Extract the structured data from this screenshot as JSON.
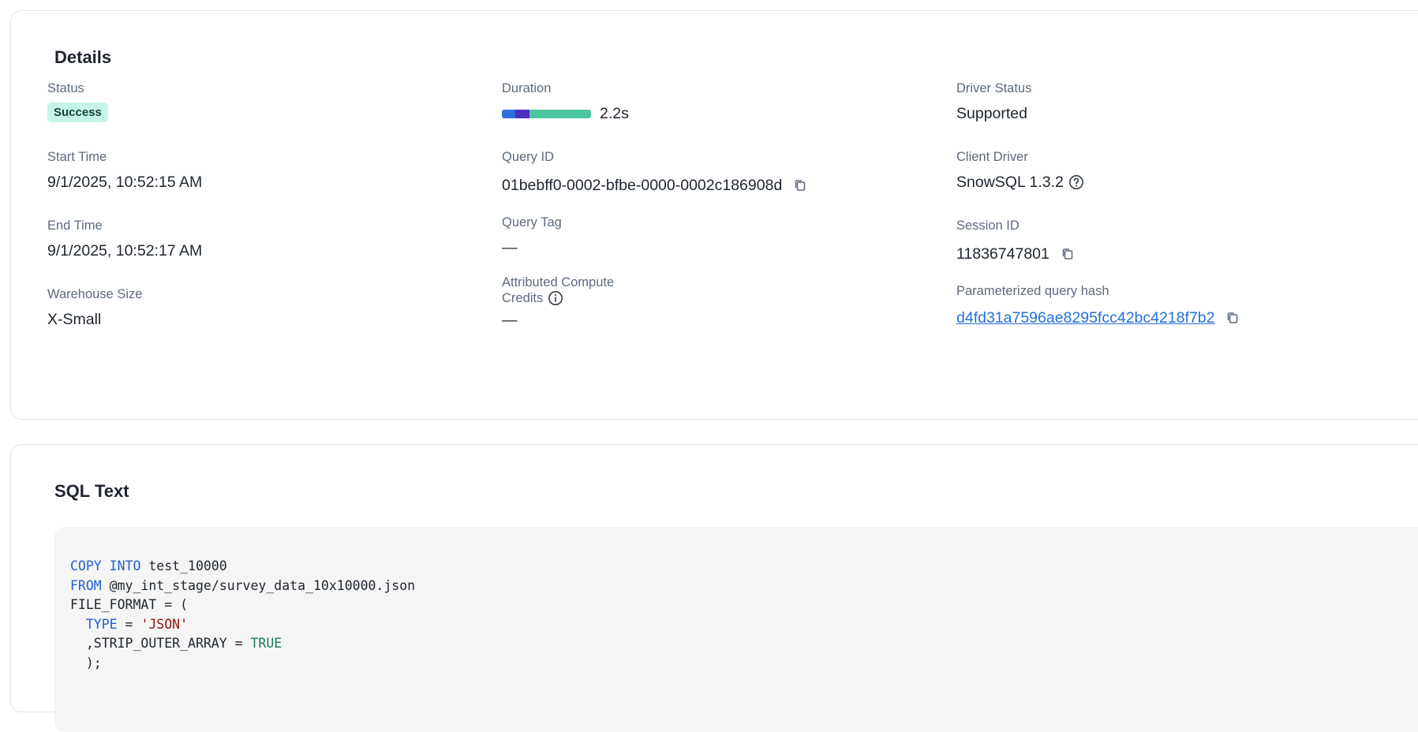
{
  "details": {
    "title": "Details",
    "status": {
      "label": "Status",
      "value": "Success"
    },
    "duration": {
      "label": "Duration",
      "value": "2.2s"
    },
    "driver_status": {
      "label": "Driver Status",
      "value": "Supported"
    },
    "start_time": {
      "label": "Start Time",
      "value": "9/1/2025, 10:52:15 AM"
    },
    "query_id": {
      "label": "Query ID",
      "value": "01bebff0-0002-bfbe-0000-0002c186908d"
    },
    "client_driver": {
      "label": "Client Driver",
      "value": "SnowSQL 1.3.2"
    },
    "end_time": {
      "label": "End Time",
      "value": "9/1/2025, 10:52:17 AM"
    },
    "query_tag": {
      "label": "Query Tag",
      "value": "—"
    },
    "session_id": {
      "label": "Session ID",
      "value": "11836747801"
    },
    "warehouse_size": {
      "label": "Warehouse Size",
      "value": "X-Small"
    },
    "attributed_credits": {
      "label_line1": "Attributed Compute",
      "label_line2": "Credits",
      "value": "—"
    },
    "query_hash": {
      "label": "Parameterized query hash",
      "value": "d4fd31a7596ae8295fcc42bc4218f7b2"
    }
  },
  "sql": {
    "title": "SQL Text",
    "lines": [
      [
        {
          "t": "COPY INTO",
          "c": "kw"
        },
        {
          "t": " test_10000",
          "c": ""
        }
      ],
      [
        {
          "t": "FROM",
          "c": "kw"
        },
        {
          "t": " @my_int_stage/survey_data_10x10000.json",
          "c": ""
        }
      ],
      [
        {
          "t": "FILE_FORMAT = (",
          "c": ""
        }
      ],
      [
        {
          "t": "  ",
          "c": ""
        },
        {
          "t": "TYPE",
          "c": "kw"
        },
        {
          "t": " = ",
          "c": ""
        },
        {
          "t": "'JSON'",
          "c": "str"
        }
      ],
      [
        {
          "t": "  ,STRIP_OUTER_ARRAY = ",
          "c": ""
        },
        {
          "t": "TRUE",
          "c": "bool"
        }
      ],
      [
        {
          "t": "  );",
          "c": ""
        }
      ]
    ]
  },
  "icons": {
    "copy": "copy-icon",
    "help": "question-circle-icon",
    "info": "info-circle-icon"
  },
  "colors": {
    "success_badge_bg": "#c7f4e9",
    "link": "#2470d8",
    "keyword": "#2160cf",
    "string": "#8a1414",
    "boolean": "#16805e"
  }
}
